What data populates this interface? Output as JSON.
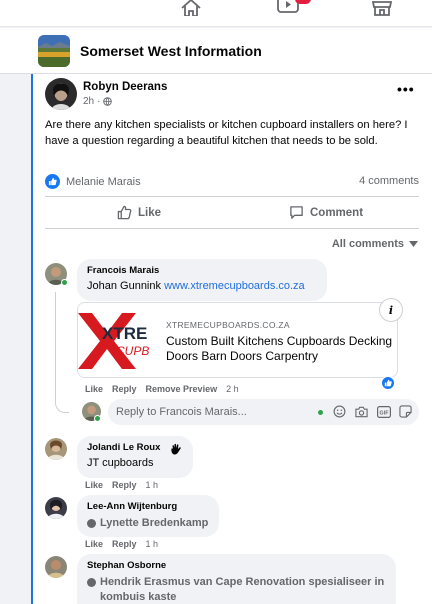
{
  "group": {
    "name": "Somerset West Information"
  },
  "post": {
    "author": "Robyn Deerans",
    "time": "2h",
    "more": "•••",
    "text": "Are there any kitchen specialists or kitchen cupboard installers on here? I have a question regarding a beautiful kitchen that needs to be sold.",
    "reactor": "Melanie Marais",
    "comment_count": "4 comments",
    "like_label": "Like",
    "comment_label": "Comment",
    "sort_label": "All comments"
  },
  "comments": [
    {
      "author": "Francois Marais",
      "text": "Johan Gunnink",
      "link": "www.xtremecupboards.co.za",
      "preview": {
        "domain": "XTREMECUPBOARDS.CO.ZA",
        "title": "Custom Built Kitchens Cupboards Decking Doors Barn Doors Carpentry",
        "thumb_text_top": "XTRE",
        "thumb_text_bottom": "CUPB"
      },
      "actions": {
        "like": "Like",
        "reply": "Reply",
        "remove": "Remove Preview",
        "time": "2 h"
      }
    },
    {
      "author": "Jolandi Le Roux",
      "text": "JT cupboards",
      "actions": {
        "like": "Like",
        "reply": "Reply",
        "time": "1 h"
      }
    },
    {
      "author": "Lee-Ann Wijtenburg",
      "tag": "Lynette Bredenkamp",
      "actions": {
        "like": "Like",
        "reply": "Reply",
        "time": "1 h"
      }
    },
    {
      "author": "Stephan Osborne",
      "tag": "Hendrik Erasmus van Cape Renovation spesialiseer in kombuis kaste"
    }
  ],
  "reply": {
    "placeholder": "Reply to Francois Marais..."
  },
  "colors": {
    "accent": "#1877f2",
    "link": "#216fdb",
    "online": "#31a24c",
    "badge": "#e41e3f",
    "xtreme_red": "#d71920"
  }
}
